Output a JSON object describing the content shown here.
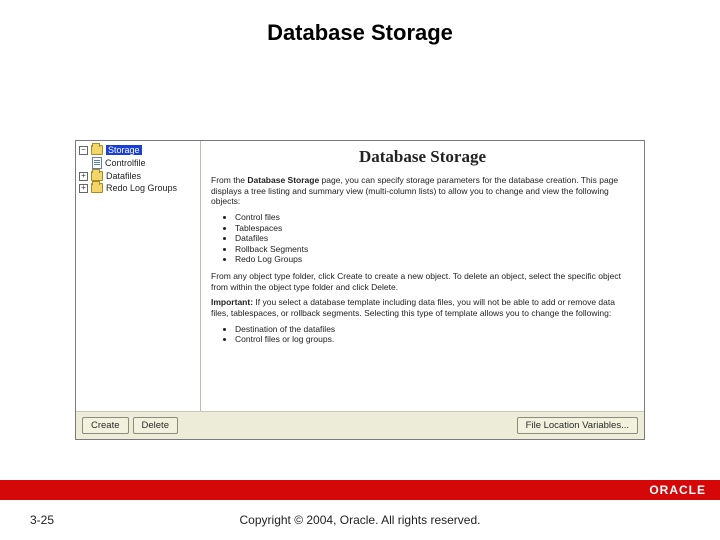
{
  "slide": {
    "title": "Database Storage",
    "page_number": "3-25",
    "copyright": "Copyright © 2004, Oracle. All rights reserved.",
    "logo": "ORACLE"
  },
  "tree": {
    "root": {
      "label": "Storage",
      "expanded": "−"
    },
    "items": [
      {
        "label": "Controlfile",
        "icon": "doc"
      },
      {
        "label": "Datafiles",
        "icon": "folder",
        "exp": "+"
      },
      {
        "label": "Redo Log Groups",
        "icon": "folder",
        "exp": "+"
      }
    ]
  },
  "content": {
    "heading": "Database Storage",
    "para1_a": "From the ",
    "para1_b": "Database Storage",
    "para1_c": " page, you can specify storage parameters for the database creation. This page displays a tree listing and summary view (multi-column lists) to allow you to change and view the following objects:",
    "list1": [
      "Control files",
      "Tablespaces",
      "Datafiles",
      "Rollback Segments",
      "Redo Log Groups"
    ],
    "para2": "From any object type folder, click Create to create a new object. To delete an object, select the specific object from within the object type folder and click Delete.",
    "para3_a": "Important:",
    "para3_b": " If you select a database template including data files, you will not be able to add or remove data files, tablespaces, or rollback segments. Selecting this type of template allows you to change the following:",
    "list2": [
      "Destination of the datafiles",
      "Control files or log groups."
    ]
  },
  "buttons": {
    "create": "Create",
    "delete": "Delete",
    "file_vars": "File Location Variables..."
  }
}
